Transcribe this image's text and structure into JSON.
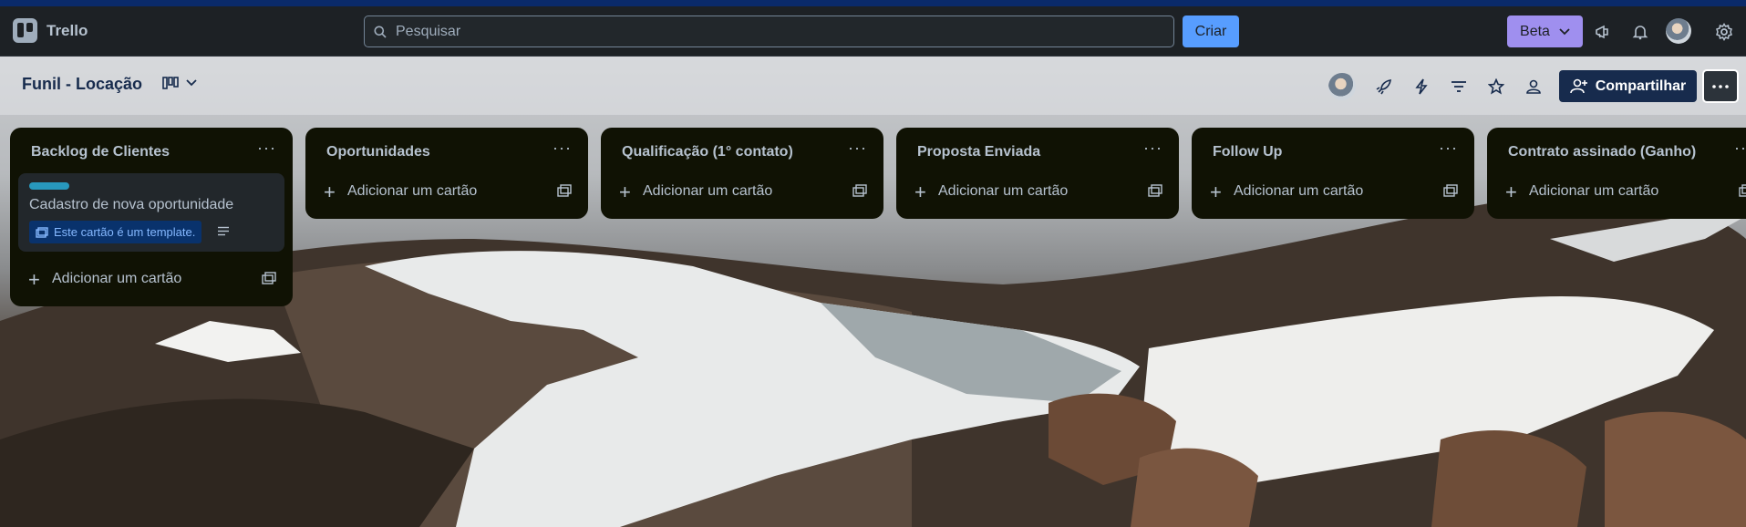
{
  "app": {
    "name": "Trello"
  },
  "topbar": {
    "search_placeholder": "Pesquisar",
    "create_label": "Criar",
    "beta_label": "Beta",
    "icons": [
      "megaphone-icon",
      "bell-icon",
      "avatar",
      "gear-icon"
    ]
  },
  "board": {
    "title": "Funil - Locação",
    "share_label": "Compartilhar",
    "header_icons": [
      "avatar",
      "rocket-icon",
      "lightning-icon",
      "filter-icon",
      "star-icon",
      "people-icon",
      "more-icon"
    ]
  },
  "lists": [
    {
      "title": "Backlog de Clientes",
      "cards": [
        {
          "title": "Cadastro de nova oportunidade",
          "template_badge": "Este cartão é um template.",
          "label_color": "#2898bd"
        }
      ],
      "add_label": "Adicionar um cartão"
    },
    {
      "title": "Oportunidades",
      "cards": [],
      "add_label": "Adicionar um cartão"
    },
    {
      "title": "Qualificação (1° contato)",
      "cards": [],
      "add_label": "Adicionar um cartão"
    },
    {
      "title": "Proposta Enviada",
      "cards": [],
      "add_label": "Adicionar um cartão"
    },
    {
      "title": "Follow Up",
      "cards": [],
      "add_label": "Adicionar um cartão"
    },
    {
      "title": "Contrato assinado (Ganho)",
      "cards": [],
      "add_label": "Adicionar um cartão"
    }
  ],
  "colors": {
    "topbar": "#1d2125",
    "accent": "#579dff",
    "beta": "#9f8fef",
    "list_bg": "#101204",
    "share_bg": "#172b4d"
  }
}
